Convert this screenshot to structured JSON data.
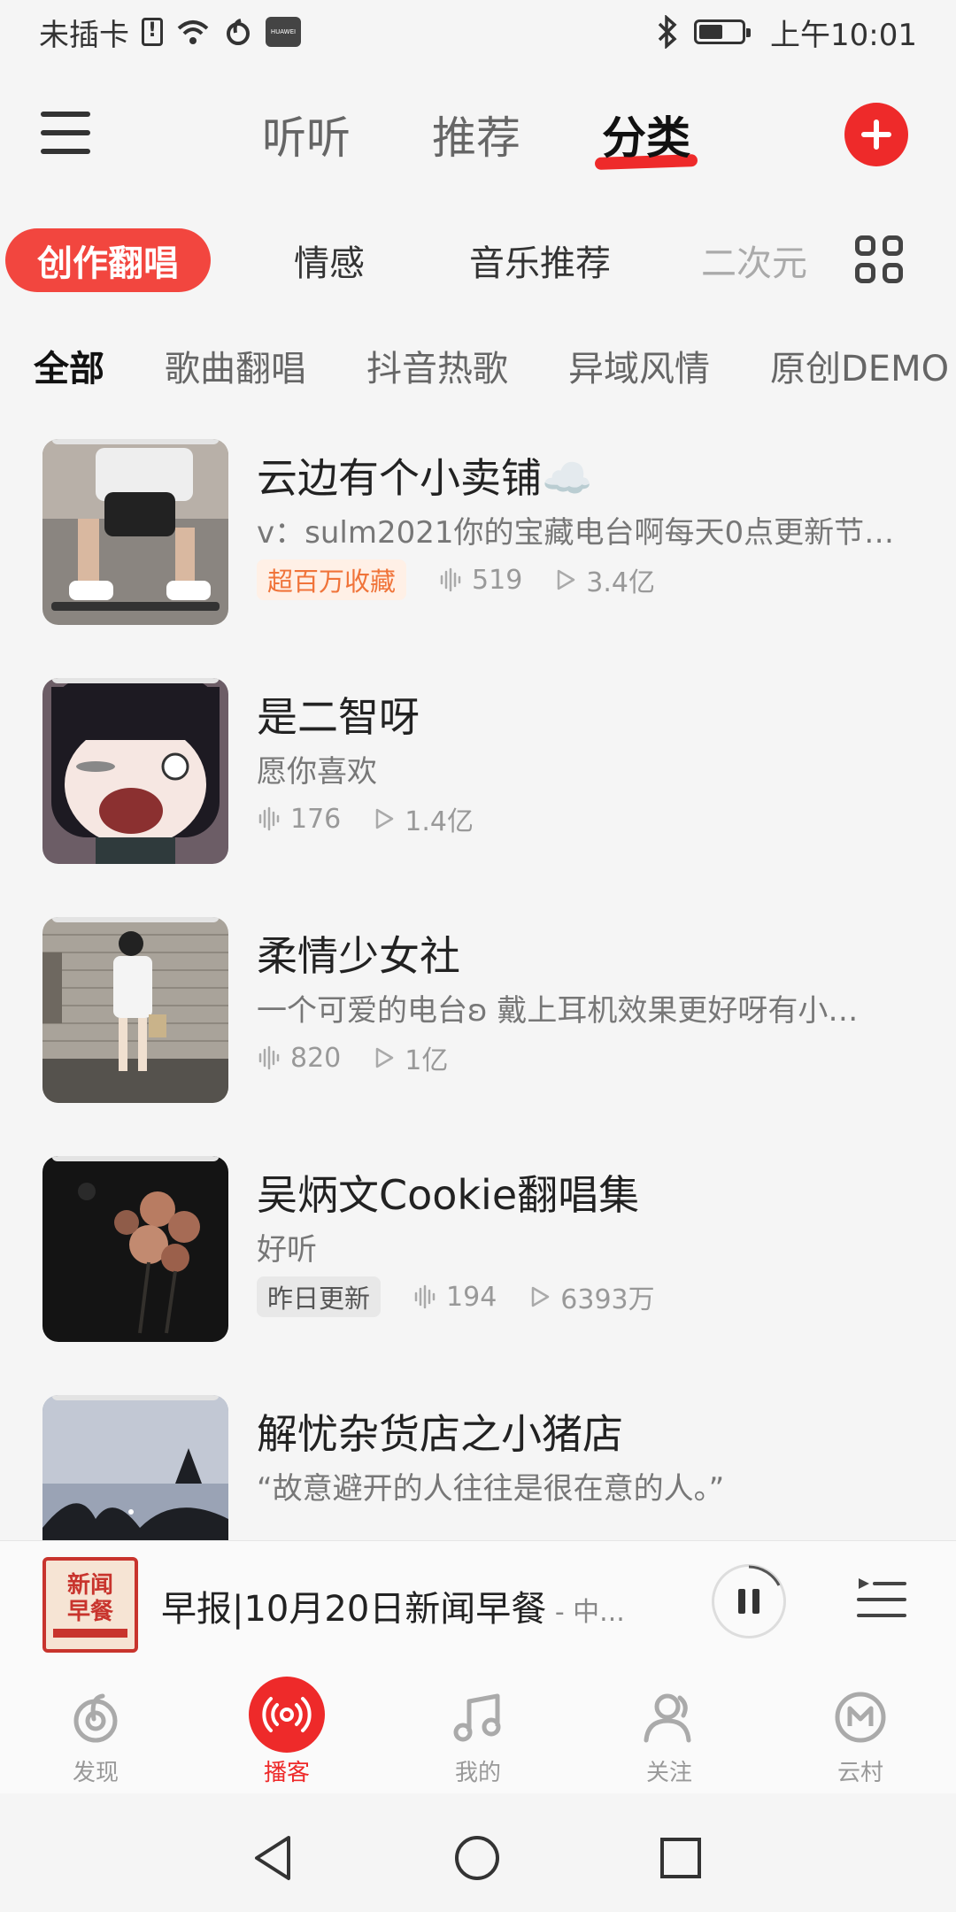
{
  "status_bar": {
    "carrier": "未插卡",
    "time": "上午10:01",
    "sim_icon": "sim-card-icon",
    "wifi_icon": "wifi-icon",
    "netease_icon": "netease-icon",
    "huawei_label": "HUAWEI",
    "bluetooth_icon": "bluetooth-icon",
    "battery_icon": "battery-icon"
  },
  "top_nav": {
    "menu_icon": "hamburger-menu-icon",
    "tabs": [
      {
        "label": "听听"
      },
      {
        "label": "推荐"
      },
      {
        "label": "分类"
      }
    ],
    "active_tab": "分类",
    "add_icon": "plus-icon"
  },
  "categories": {
    "items": [
      {
        "label": "创作翻唱"
      },
      {
        "label": "情感"
      },
      {
        "label": "音乐推荐"
      },
      {
        "label": "二次元"
      }
    ],
    "active": "创作翻唱",
    "more_icon": "grid-icon"
  },
  "subcategories": {
    "items": [
      {
        "label": "全部"
      },
      {
        "label": "歌曲翻唱"
      },
      {
        "label": "抖音热歌"
      },
      {
        "label": "异域风情"
      },
      {
        "label": "原创DEMO"
      }
    ],
    "active": "全部"
  },
  "podcasts": [
    {
      "title": "云边有个小卖铺☁️",
      "desc": "v：sulm2021你的宝藏电台啊每天0点更新节…",
      "badge": "超百万收藏",
      "badge_style": "orange",
      "episodes": "519",
      "plays": "3.4亿"
    },
    {
      "title": "是二智呀",
      "desc": "愿你喜欢",
      "badge": "",
      "badge_style": "",
      "episodes": "176",
      "plays": "1.4亿"
    },
    {
      "title": "柔情少女社",
      "desc": "一个可爱的电台ʚ 戴上耳机效果更好呀有小…",
      "badge": "",
      "badge_style": "",
      "episodes": "820",
      "plays": "1亿"
    },
    {
      "title": "吴炳文Cookie翻唱集",
      "desc": "好听",
      "badge": "昨日更新",
      "badge_style": "gray",
      "episodes": "194",
      "plays": "6393万"
    },
    {
      "title": "解忧杂货店之小猪店",
      "desc": "“故意避开的人往往是很在意的人。”",
      "badge": "",
      "badge_style": "",
      "episodes": "",
      "plays": ""
    }
  ],
  "player": {
    "cover_text_1": "新闻",
    "cover_text_2": "早餐",
    "title": "早报|10月20日新闻早餐",
    "subtitle": " - 中...",
    "pause_icon": "pause-icon",
    "playlist_icon": "playlist-icon"
  },
  "bottom_tabs": [
    {
      "label": "发现",
      "icon": "netease-logo-icon"
    },
    {
      "label": "播客",
      "icon": "podcast-broadcast-icon"
    },
    {
      "label": "我的",
      "icon": "music-note-icon"
    },
    {
      "label": "关注",
      "icon": "people-icon"
    },
    {
      "label": "云村",
      "icon": "cloud-village-icon"
    }
  ],
  "active_bottom_tab": "播客",
  "system_nav": {
    "back_icon": "back-triangle-icon",
    "home_icon": "home-circle-icon",
    "recents_icon": "recents-square-icon"
  },
  "colors": {
    "accent": "#ee2a2a",
    "badge_orange_text": "#f0743a",
    "badge_orange_bg": "#fff0e6",
    "background": "#f5f5f5"
  }
}
